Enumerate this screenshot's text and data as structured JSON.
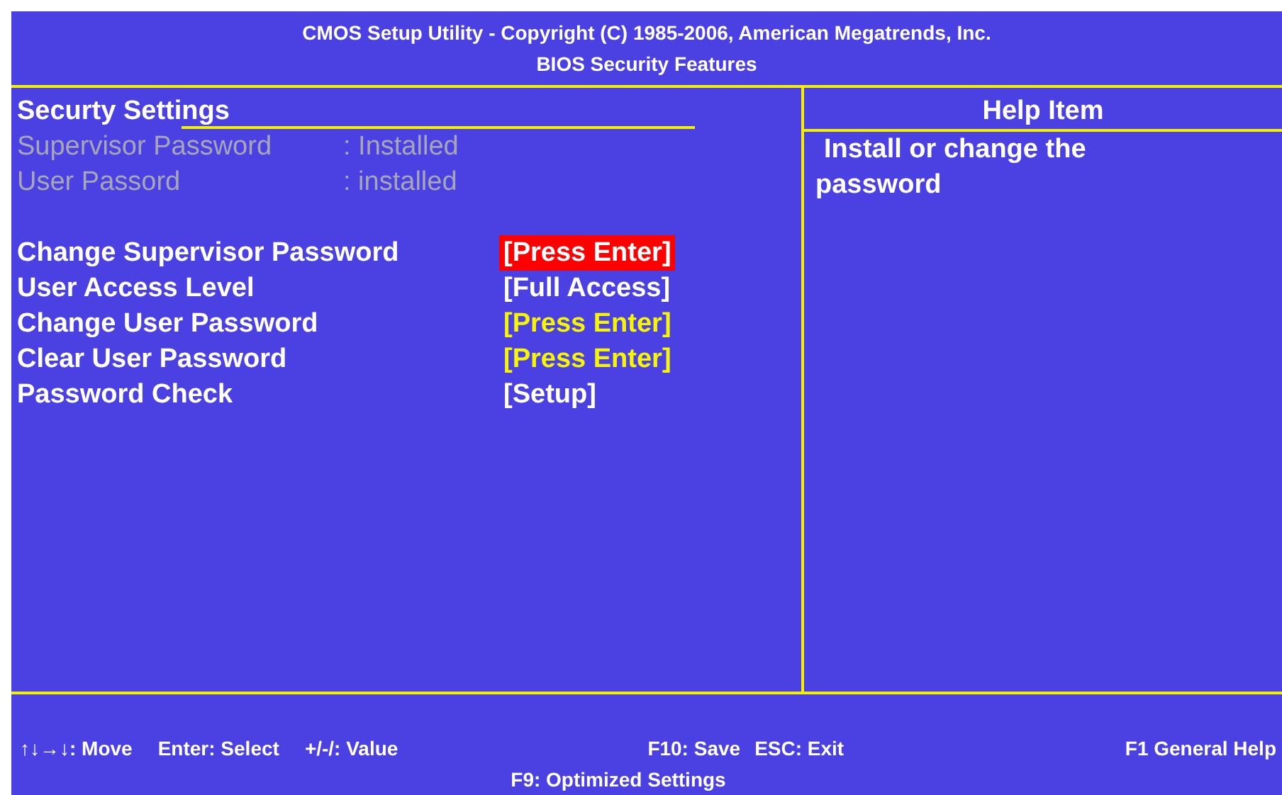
{
  "header": {
    "title": "CMOS Setup Utility - Copyright (C) 1985-2006, American Megatrends, Inc.",
    "subtitle": "BIOS Security Features"
  },
  "settings": {
    "title": "Securty Settings",
    "info": [
      {
        "label": "Supervisor Password",
        "value": ": Installed"
      },
      {
        "label": "User Passord",
        "value": ": installed"
      }
    ],
    "items": [
      {
        "label": "Change Supervisor Password",
        "value": "[Press Enter]",
        "kind": "action",
        "selected": true
      },
      {
        "label": "User Access Level",
        "value": "[Full Access]",
        "kind": "option",
        "selected": false
      },
      {
        "label": "Change User Password",
        "value": "[Press Enter]",
        "kind": "action",
        "selected": false
      },
      {
        "label": "Clear User Password",
        "value": "[Press Enter]",
        "kind": "action",
        "selected": false
      },
      {
        "label": "Password Check",
        "value": "[Setup]",
        "kind": "option",
        "selected": false
      }
    ]
  },
  "help": {
    "title": "Help Item",
    "lines": [
      "Install or change the",
      "password"
    ]
  },
  "footer": {
    "left": [
      "↑↓→↓: Move",
      "Enter: Select",
      "+/-/: Value"
    ],
    "middle": [
      "F10: Save",
      "ESC: Exit"
    ],
    "right": "F1 General Help",
    "bottom": "F9: Optimized Settings"
  }
}
